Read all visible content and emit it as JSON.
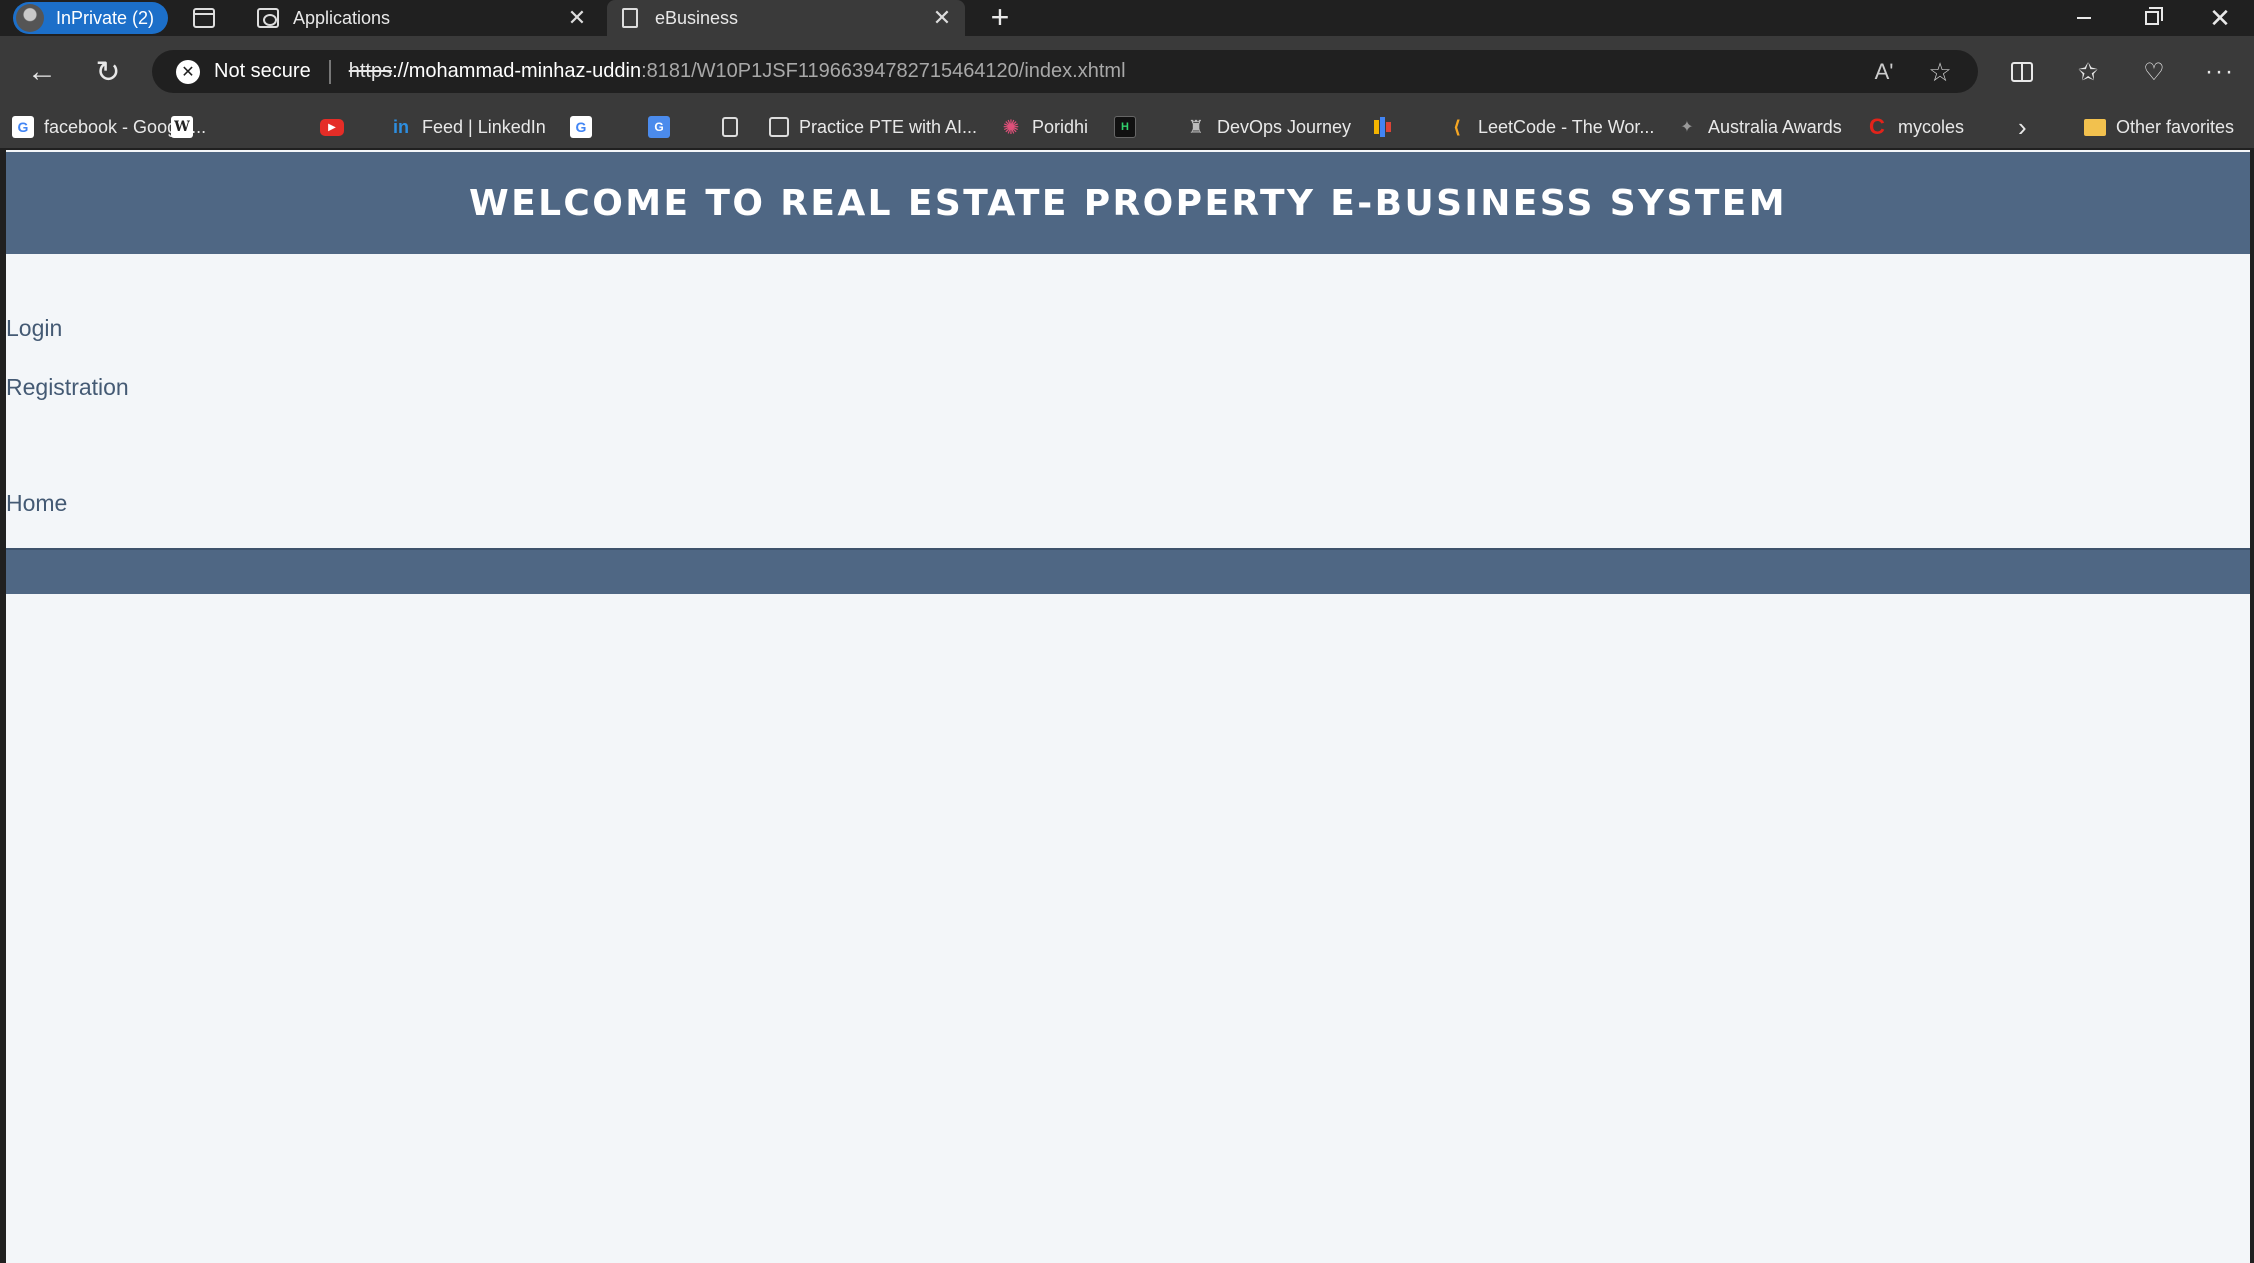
{
  "browser": {
    "profile_label": "InPrivate (2)",
    "tabs": [
      {
        "title": "Applications",
        "close": "✕"
      },
      {
        "title": "eBusiness",
        "close": "✕"
      }
    ],
    "new_tab": "+",
    "security_label": "Not secure",
    "url": {
      "scheme": "https",
      "host": "://mohammad-minhaz-uddin",
      "rest": ":8181/W10P1JSF11966394782715464120/index.xhtml"
    },
    "read_aloud": "Aʹ",
    "favorites_bar": [
      {
        "label": "facebook - Google...",
        "icon": "google-icon"
      },
      {
        "label": "",
        "icon": "wikipedia-icon"
      },
      {
        "label": "",
        "icon": "youtube-icon"
      },
      {
        "label": "Feed | LinkedIn",
        "icon": "linkedin-icon"
      },
      {
        "label": "",
        "icon": "google-icon"
      },
      {
        "label": "",
        "icon": "translate-icon"
      },
      {
        "label": "",
        "icon": "document-icon"
      },
      {
        "label": "Practice PTE with AI...",
        "icon": "pte-icon"
      },
      {
        "label": "Poridhi",
        "icon": "poridhi-icon"
      },
      {
        "label": "",
        "icon": "hackerrank-icon"
      },
      {
        "label": "DevOps Journey",
        "icon": "devops-icon"
      },
      {
        "label": "",
        "icon": "bar-chart-icon"
      },
      {
        "label": "LeetCode - The Wor...",
        "icon": "leetcode-icon"
      },
      {
        "label": "Australia Awards",
        "icon": "australia-awards-icon"
      },
      {
        "label": "mycoles",
        "icon": "coles-icon"
      }
    ],
    "overflow_chevron": "›",
    "other_favorites": "Other favorites"
  },
  "page": {
    "header_title": "WELCOME TO REAL ESTATE PROPERTY E-BUSINESS SYSTEM",
    "links": {
      "login": "Login",
      "registration": "Registration",
      "home": "Home"
    },
    "colors": {
      "header_bg": "#4f6784",
      "page_bg": "#f3f6f9",
      "link": "#445a74"
    }
  }
}
